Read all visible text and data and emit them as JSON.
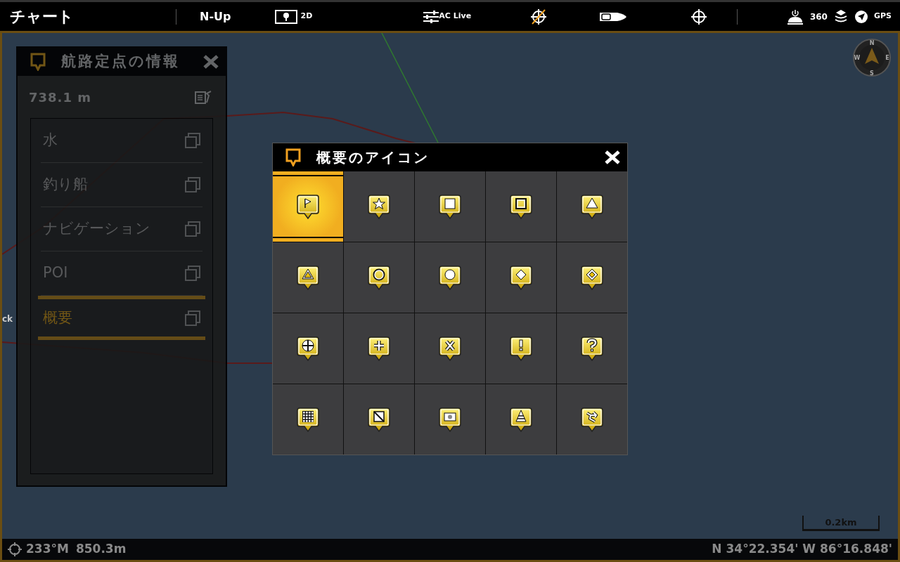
{
  "top_bar": {
    "title": "チャート",
    "orientation": "N-Up",
    "view_mode": "2D",
    "ac_live": "AC Live",
    "sonar_360": "360",
    "gps": "GPS"
  },
  "map": {
    "label": "ck",
    "compass": {
      "n": "N",
      "e": "E",
      "s": "S",
      "w": "W"
    },
    "scale": "0.2km"
  },
  "waypoint_panel": {
    "title": "航路定点の情報",
    "distance": "738.1 m",
    "items": [
      {
        "label": "水",
        "selected": false
      },
      {
        "label": "釣り船",
        "selected": false
      },
      {
        "label": "ナビゲーション",
        "selected": false
      },
      {
        "label": "POI",
        "selected": false
      },
      {
        "label": "概要",
        "selected": true
      }
    ]
  },
  "icon_dialog": {
    "title": "概要のアイコン",
    "icons": [
      {
        "kind": "flag",
        "selected": true
      },
      {
        "kind": "star",
        "selected": false
      },
      {
        "kind": "square",
        "selected": false
      },
      {
        "kind": "squareoutline",
        "selected": false
      },
      {
        "kind": "triangle",
        "selected": false
      },
      {
        "kind": "triangleoutline",
        "selected": false
      },
      {
        "kind": "ring",
        "selected": false
      },
      {
        "kind": "circle",
        "selected": false
      },
      {
        "kind": "diamond",
        "selected": false
      },
      {
        "kind": "diamondoutline",
        "selected": false
      },
      {
        "kind": "crosshair",
        "selected": false
      },
      {
        "kind": "plus",
        "selected": false
      },
      {
        "kind": "cross",
        "selected": false
      },
      {
        "kind": "exclamation",
        "selected": false
      },
      {
        "kind": "question",
        "selected": false
      },
      {
        "kind": "grid",
        "selected": false
      },
      {
        "kind": "slash",
        "selected": false
      },
      {
        "kind": "camera",
        "selected": false
      },
      {
        "kind": "cone",
        "selected": false
      },
      {
        "kind": "diver",
        "selected": false
      }
    ]
  },
  "status_bar": {
    "heading": "233°M",
    "range": "850.3m",
    "position": "N 34°22.354' W 86°16.848'"
  }
}
